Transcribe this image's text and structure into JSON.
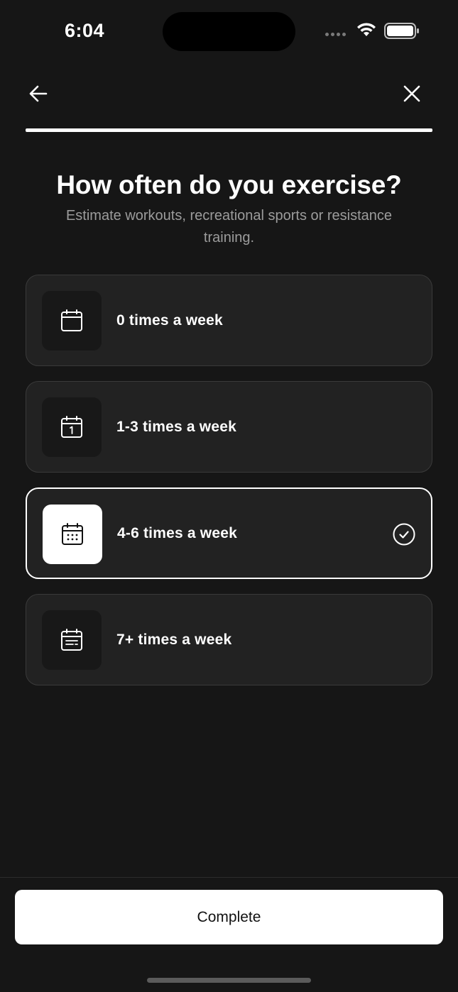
{
  "status_bar": {
    "time": "6:04"
  },
  "nav": {
    "back_icon": "arrow-left-icon",
    "close_icon": "close-icon"
  },
  "progress": {
    "fraction": 1.0
  },
  "header": {
    "title": "How often do you exercise?",
    "subtitle": "Estimate workouts, recreational sports or resistance training."
  },
  "options": [
    {
      "label": "0 times a week",
      "icon": "calendar-empty-icon",
      "selected": false
    },
    {
      "label": "1-3 times a week",
      "icon": "calendar-one-icon",
      "selected": false
    },
    {
      "label": "4-6 times a week",
      "icon": "calendar-dots-icon",
      "selected": true
    },
    {
      "label": "7+ times a week",
      "icon": "calendar-lines-icon",
      "selected": false
    }
  ],
  "footer": {
    "complete_label": "Complete"
  },
  "colors": {
    "background": "#161616",
    "card": "#222222",
    "card_border": "#3a3a3a",
    "selected_border": "#ffffff",
    "subtitle": "#9c9c9c"
  }
}
